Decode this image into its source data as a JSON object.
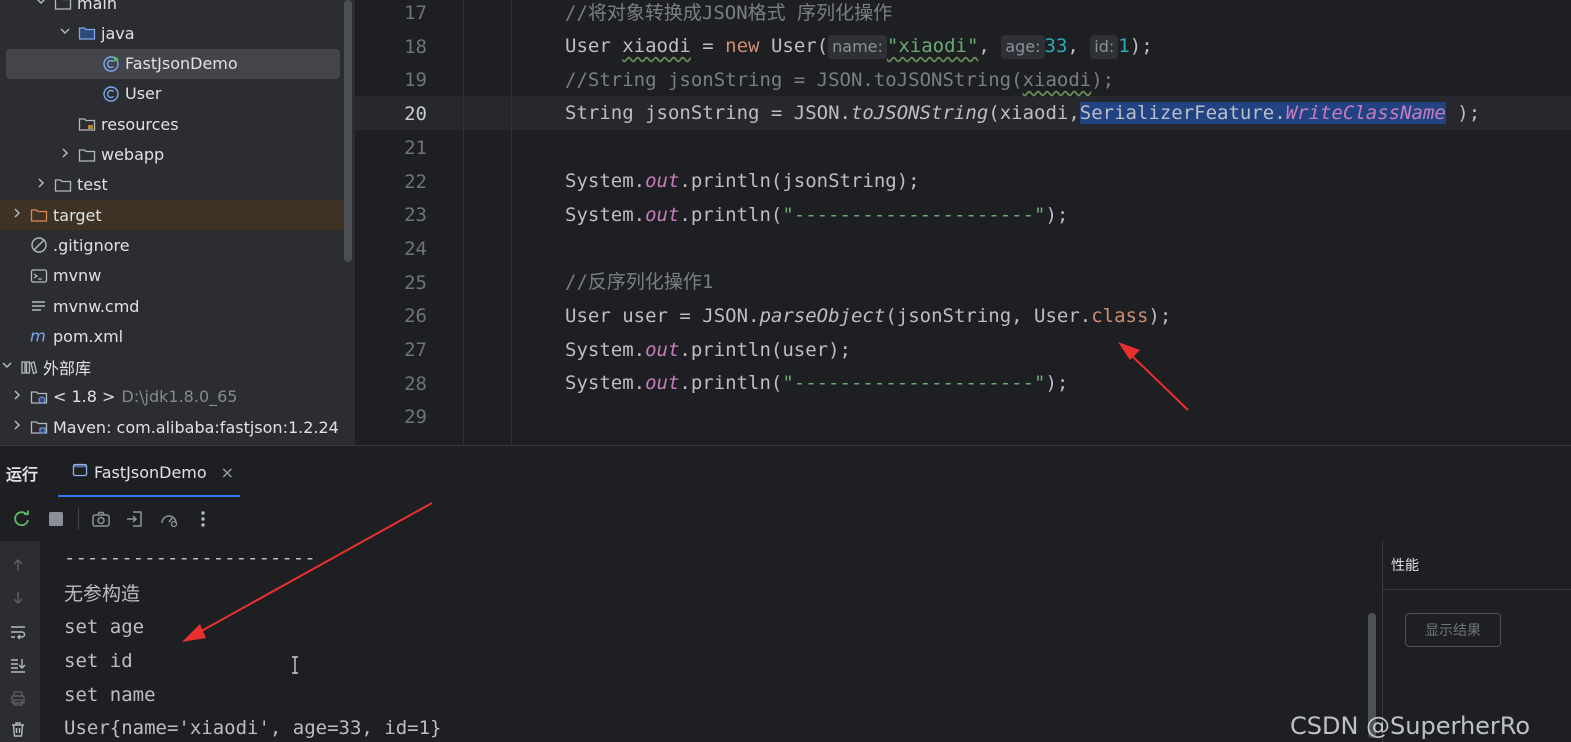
{
  "project_tree": {
    "rows": [
      {
        "label": "main",
        "extra": "",
        "arrow": "down",
        "icon": "folder-icon",
        "indent": 1
      },
      {
        "label": "java",
        "extra": "",
        "arrow": "down",
        "icon": "source-folder-icon",
        "indent": 2
      },
      {
        "label": "FastJsonDemo",
        "extra": "",
        "arrow": "",
        "icon": "java-class-run-icon",
        "indent": 3,
        "selected": true
      },
      {
        "label": "User",
        "extra": "",
        "arrow": "",
        "icon": "java-class-icon",
        "indent": 3
      },
      {
        "label": "resources",
        "extra": "",
        "arrow": "",
        "icon": "resources-folder-icon",
        "indent": 2
      },
      {
        "label": "webapp",
        "extra": "",
        "arrow": "right",
        "icon": "folder-icon",
        "indent": 2
      },
      {
        "label": "test",
        "extra": "",
        "arrow": "right",
        "icon": "folder-icon",
        "indent": 1
      },
      {
        "label": "target",
        "extra": "",
        "arrow": "right",
        "icon": "excluded-folder-icon",
        "indent": 0,
        "highlight": true
      },
      {
        "label": ".gitignore",
        "extra": "",
        "arrow": "",
        "icon": "ignore-file-icon",
        "indent": 0
      },
      {
        "label": "mvnw",
        "extra": "",
        "arrow": "",
        "icon": "shell-file-icon",
        "indent": 0
      },
      {
        "label": "mvnw.cmd",
        "extra": "",
        "arrow": "",
        "icon": "text-file-icon",
        "indent": 0
      },
      {
        "label": "pom.xml",
        "extra": "",
        "arrow": "",
        "icon": "maven-icon",
        "indent": 0
      },
      {
        "label": "外部库",
        "extra": "",
        "arrow": "down",
        "icon": "library-icon",
        "indent": -1
      },
      {
        "label": "< 1.8 >",
        "extra": "D:\\jdk1.8.0_65",
        "arrow": "right",
        "icon": "jdk-icon",
        "indent": 0
      },
      {
        "label": "Maven: com.alibaba:fastjson:1.2.24",
        "extra": "",
        "arrow": "right",
        "icon": "jar-library-icon",
        "indent": 0
      }
    ]
  },
  "editor": {
    "line_numbers": [
      "17",
      "18",
      "19",
      "20",
      "21",
      "22",
      "23",
      "24",
      "25",
      "26",
      "27",
      "28",
      "29"
    ],
    "current_line": "20",
    "code": {
      "l17": "//将对象转换成JSON格式 序列化操作",
      "l18": {
        "a": "User ",
        "b": "xiaodi",
        "c": " = ",
        "d": "new",
        "e": " User(",
        "hint1": "name:",
        "f": "\"xiaodi\"",
        "g": ", ",
        "hint2": "age:",
        "h": "33",
        "i": ", ",
        "hint3": "id:",
        "j": "1",
        "k": ");"
      },
      "l19": {
        "a": "//String jsonString = JSON.toJSONString(",
        "b": "xiaodi",
        "c": ");"
      },
      "l20": {
        "a": "String jsonString = JSON.",
        "b": "toJSONString",
        "c": "(xiaodi,",
        "d": "SerializerFeature.",
        "e": "WriteClassName",
        "f": " );"
      },
      "l22": {
        "a": "System.",
        "b": "out",
        "c": ".println(jsonString);"
      },
      "l23": {
        "a": "System.",
        "b": "out",
        "c": ".println(",
        "d": "\"---------------------\"",
        "e": ");"
      },
      "l25": "//反序列化操作1",
      "l26": {
        "a": "User user = JSON.",
        "b": "parseObject",
        "c": "(jsonString, User.",
        "d": "class",
        "e": ");"
      },
      "l27": {
        "a": "System.",
        "b": "out",
        "c": ".println(user);"
      },
      "l28": {
        "a": "System.",
        "b": "out",
        "c": ".println(",
        "d": "\"---------------------\"",
        "e": ");"
      }
    }
  },
  "run_window": {
    "title": "运行",
    "tab_label": "FastJsonDemo",
    "tab_close": "×",
    "output_lines": [
      "----------------------",
      "无参构造",
      "set age",
      "set id",
      "set name",
      "User{name='xiaodi', age=33, id=1}"
    ],
    "perf_title": "性能",
    "perf_button": "显示结果"
  },
  "watermark": "CSDN @SuperherRo",
  "colors": {
    "keyword": "#cf8e6d",
    "string": "#6aab73",
    "number": "#2aacb8",
    "comment": "#7a7e85",
    "static_field": "#c77dbb",
    "selection": "#214283",
    "accent": "#3574f0",
    "annotation_arrow": "#e8312f"
  }
}
